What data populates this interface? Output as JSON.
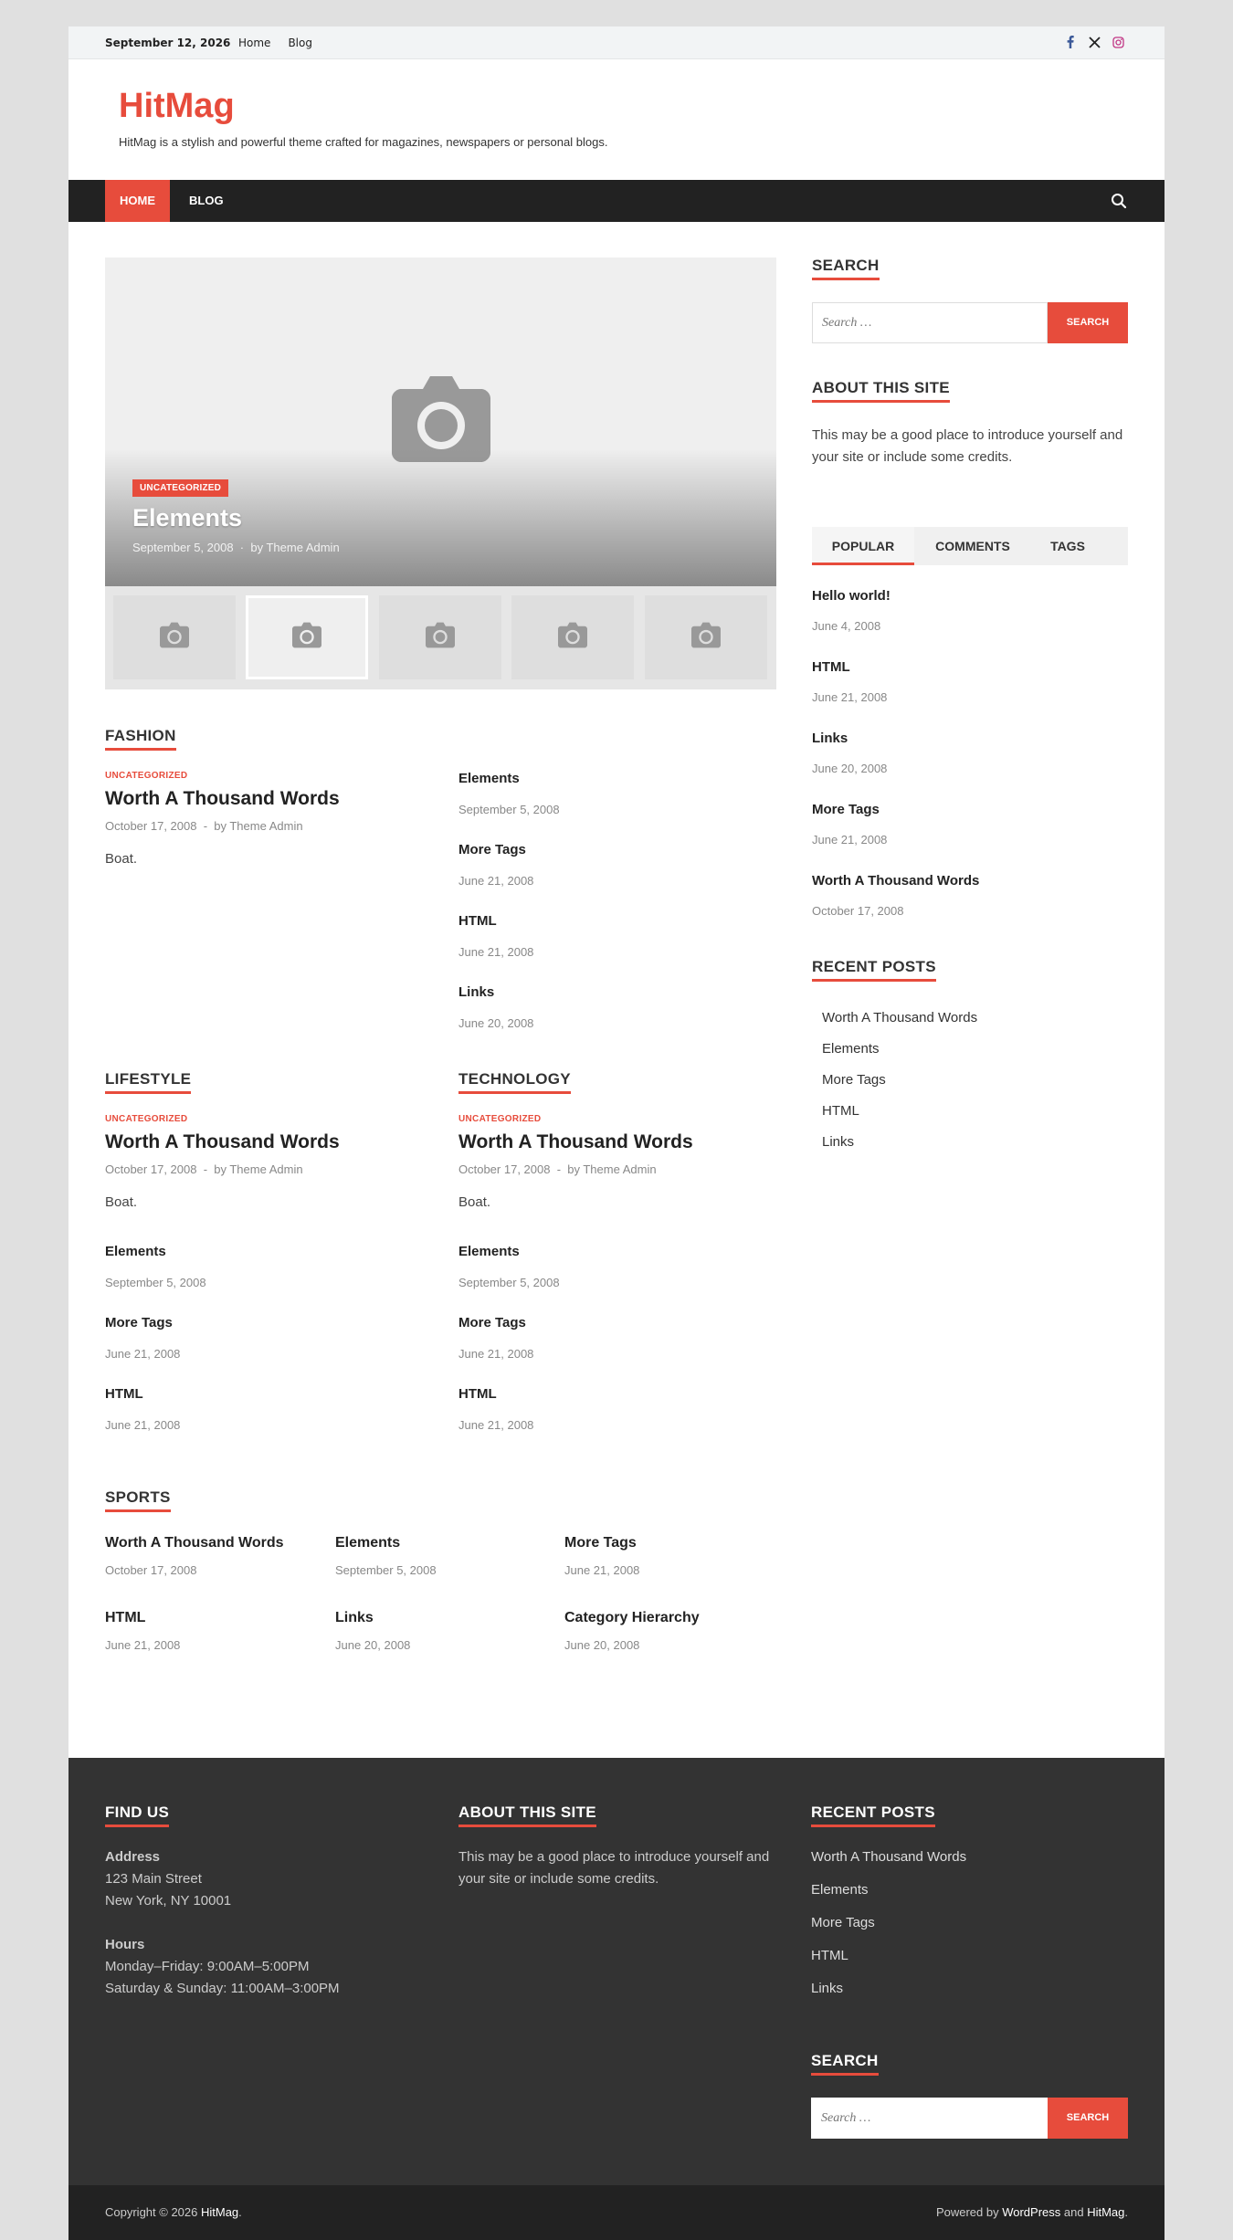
{
  "topbar": {
    "date": "September 12, 2026",
    "links": [
      "Home",
      "Blog"
    ]
  },
  "brand": {
    "name": "HitMag",
    "tagline": "HitMag is a stylish and powerful theme crafted for magazines, newspapers or personal blogs."
  },
  "nav": {
    "home": "HOME",
    "blog": "BLOG"
  },
  "slider": {
    "category": "UNCATEGORIZED",
    "title": "Elements",
    "date": "September 5, 2008",
    "author": "by Theme Admin"
  },
  "fashion": {
    "title": "FASHION",
    "featured": {
      "category": "UNCATEGORIZED",
      "title": "Worth A Thousand Words",
      "date": "October 17, 2008",
      "author": "by Theme Admin",
      "excerpt": "Boat."
    },
    "list": [
      {
        "title": "Elements",
        "date": "September 5, 2008"
      },
      {
        "title": "More Tags",
        "date": "June 21, 2008"
      },
      {
        "title": "HTML",
        "date": "June 21, 2008"
      },
      {
        "title": "Links",
        "date": "June 20, 2008"
      }
    ]
  },
  "lifestyle": {
    "title": "LIFESTYLE",
    "featured": {
      "category": "UNCATEGORIZED",
      "title": "Worth A Thousand Words",
      "date": "October 17, 2008",
      "author": "by Theme Admin",
      "excerpt": "Boat."
    },
    "list": [
      {
        "title": "Elements",
        "date": "September 5, 2008"
      },
      {
        "title": "More Tags",
        "date": "June 21, 2008"
      },
      {
        "title": "HTML",
        "date": "June 21, 2008"
      }
    ]
  },
  "technology": {
    "title": "TECHNOLOGY",
    "featured": {
      "category": "UNCATEGORIZED",
      "title": "Worth A Thousand Words",
      "date": "October 17, 2008",
      "author": "by Theme Admin",
      "excerpt": "Boat."
    },
    "list": [
      {
        "title": "Elements",
        "date": "September 5, 2008"
      },
      {
        "title": "More Tags",
        "date": "June 21, 2008"
      },
      {
        "title": "HTML",
        "date": "June 21, 2008"
      }
    ]
  },
  "sports": {
    "title": "SPORTS",
    "items": [
      {
        "title": "Worth A Thousand Words",
        "date": "October 17, 2008"
      },
      {
        "title": "Elements",
        "date": "September 5, 2008"
      },
      {
        "title": "More Tags",
        "date": "June 21, 2008"
      },
      {
        "title": "HTML",
        "date": "June 21, 2008"
      },
      {
        "title": "Links",
        "date": "June 20, 2008"
      },
      {
        "title": "Category Hierarchy",
        "date": "June 20, 2008"
      }
    ]
  },
  "sidebar": {
    "search_title": "SEARCH",
    "search_placeholder": "Search …",
    "search_button": "SEARCH",
    "about_title": "ABOUT THIS SITE",
    "about_text": "This may be a good place to introduce yourself and your site or include some credits.",
    "tabs": [
      "POPULAR",
      "COMMENTS",
      "TAGS"
    ],
    "popular": [
      {
        "title": "Hello world!",
        "date": "June 4, 2008"
      },
      {
        "title": "HTML",
        "date": "June 21, 2008"
      },
      {
        "title": "Links",
        "date": "June 20, 2008"
      },
      {
        "title": "More Tags",
        "date": "June 21, 2008"
      },
      {
        "title": "Worth A Thousand Words",
        "date": "October 17, 2008"
      }
    ],
    "recent_title": "RECENT POSTS",
    "recent": [
      "Worth A Thousand Words",
      "Elements",
      "More Tags",
      "HTML",
      "Links"
    ]
  },
  "footer": {
    "findus_title": "FIND US",
    "address_label": "Address",
    "address_line1": "123 Main Street",
    "address_line2": "New York, NY 10001",
    "hours_label": "Hours",
    "hours_line1": "Monday–Friday: 9:00AM–5:00PM",
    "hours_line2": "Saturday & Sunday: 11:00AM–3:00PM",
    "about_title": "ABOUT THIS SITE",
    "about_text": "This may be a good place to introduce yourself and your site or include some credits.",
    "recent_title": "RECENT POSTS",
    "recent": [
      "Worth A Thousand Words",
      "Elements",
      "More Tags",
      "HTML",
      "Links"
    ],
    "search_title": "SEARCH",
    "search_placeholder": "Search …",
    "search_button": "SEARCH"
  },
  "bottombar": {
    "copyright_prefix": "Copyright © 2026 ",
    "copyright_brand": "HitMag",
    "copyright_suffix": ".",
    "powered_prefix": "Powered by ",
    "powered_wp": "WordPress",
    "powered_and": " and ",
    "powered_theme": "HitMag",
    "powered_suffix": "."
  },
  "colors": {
    "accent": "#e74c3c",
    "dark": "#222222",
    "footer": "#333333"
  }
}
